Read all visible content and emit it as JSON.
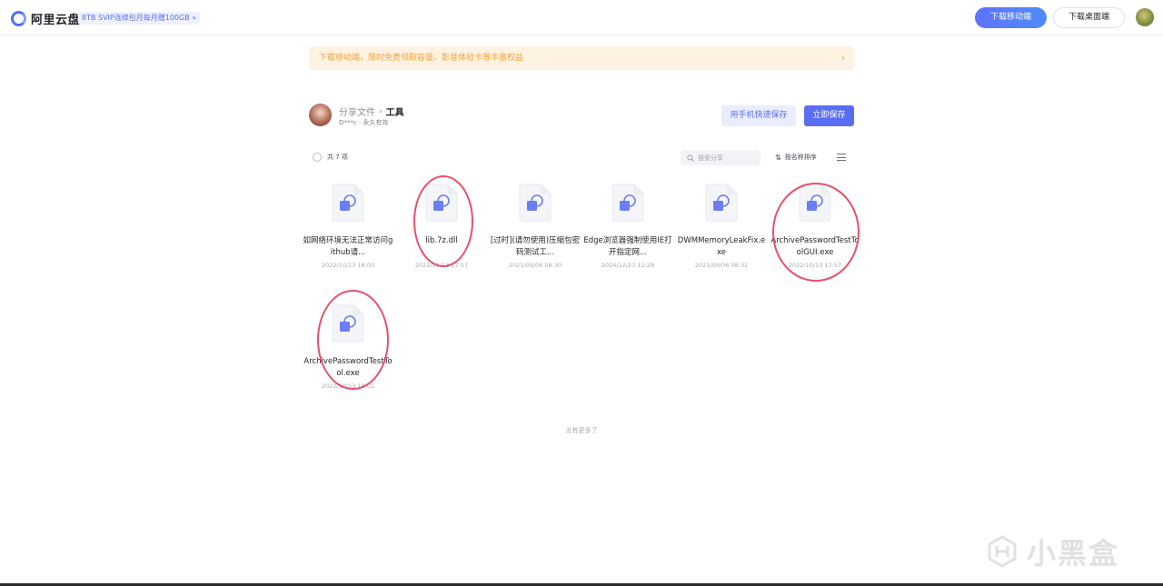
{
  "header": {
    "logo_text": "阿里云盘",
    "svip_badge": "8TB SVIP连续包月每月赠100GB »",
    "download_mobile": "下载移动端",
    "download_desktop": "下载桌面端"
  },
  "banner": {
    "text": "下载移动端，限时免费领取容量、影音体验卡等丰富权益",
    "arrow": "›"
  },
  "share": {
    "breadcrumb_parent": "分享文件",
    "breadcrumb_sep": "›",
    "breadcrumb_current": "工具",
    "meta": "D***c · 永久有效",
    "save_by_phone": "用手机快速保存",
    "save_now": "立即保存"
  },
  "toolbar": {
    "total": "共 7 项",
    "search_placeholder": "搜索分享",
    "sort_icon": "⇅",
    "sort_label": "按名称排序"
  },
  "files": [
    {
      "name": "如网络环境无法正常访问github请...",
      "date": "2022/10/13 18:00"
    },
    {
      "name": "lib.7z.dll",
      "date": "2022/10/13 17:57"
    },
    {
      "name": "[过时](请勿使用)压缩包密码测试工...",
      "date": "2021/09/06 08:30"
    },
    {
      "name": "Edge浏览器强制使用IE打开指定网...",
      "date": "2024/12/27 12:29"
    },
    {
      "name": "DWMMemoryLeakFix.exe",
      "date": "2021/09/06 08:31"
    },
    {
      "name": "ArchivePasswordTestToolGUI.exe",
      "date": "2022/10/13 17:57"
    },
    {
      "name": "ArchivePasswordTestTool.exe",
      "date": "2022/10/13 18:01"
    }
  ],
  "footer": {
    "no_more": "没有更多了",
    "watermark": "小黑盒"
  },
  "colors": {
    "accent": "#5b6ef3",
    "banner_bg": "#fef3e3",
    "banner_text": "#f2a33a",
    "annotation": "#e8506a"
  }
}
